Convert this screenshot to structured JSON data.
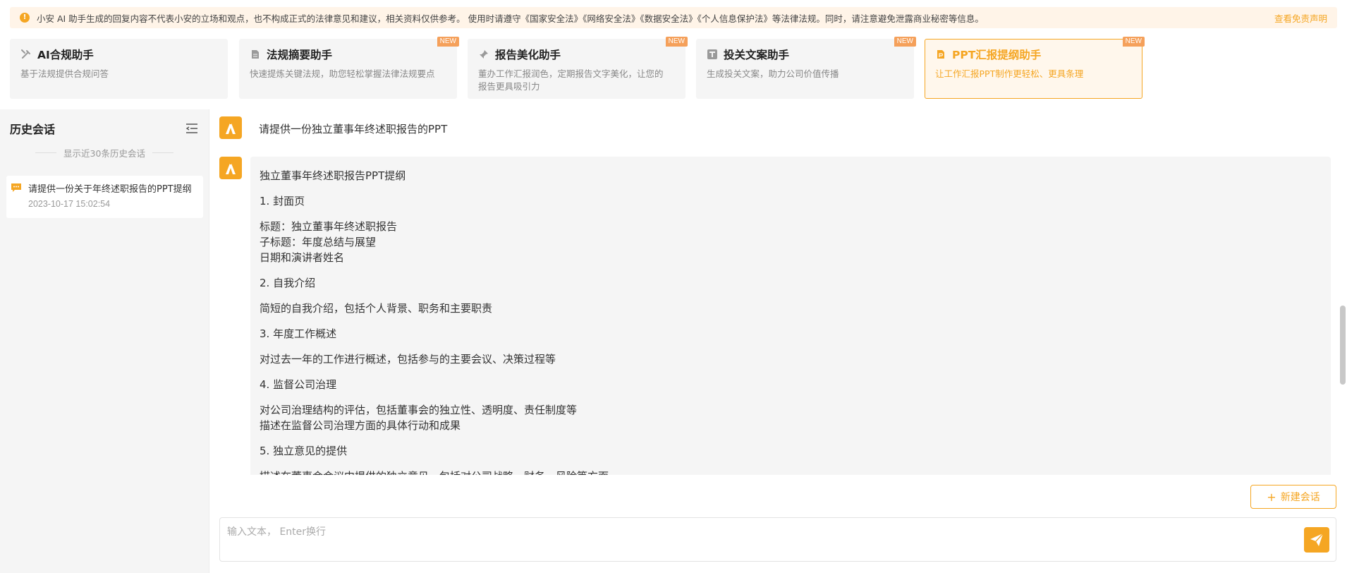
{
  "notice": {
    "text": "小安 AI 助手生成的回复内容不代表小安的立场和观点，也不构成正式的法律意见和建议，相关资料仅供参考。 使用时请遵守《国家安全法》《网络安全法》《数据安全法》《个人信息保护法》等法律法规。同时，请注意避免泄露商业秘密等信息。",
    "link": "查看免责声明"
  },
  "tools": [
    {
      "title": "AI合规助手",
      "desc": "基于法规提供合规问答",
      "badge": "",
      "icon": "tools-icon"
    },
    {
      "title": "法规摘要助手",
      "desc": "快速提炼关键法规，助您轻松掌握法律法规要点",
      "badge": "NEW",
      "icon": "document-icon"
    },
    {
      "title": "报告美化助手",
      "desc": "董办工作汇报润色，定期报告文字美化，让您的报告更具吸引力",
      "badge": "NEW",
      "icon": "pin-icon"
    },
    {
      "title": "投关文案助手",
      "desc": "生成投关文案，助力公司价值传播",
      "badge": "NEW",
      "icon": "text-icon"
    },
    {
      "title": "PPT汇报提纲助手",
      "desc": "让工作汇报PPT制作更轻松、更具条理",
      "badge": "NEW",
      "icon": "ppt-file-icon"
    }
  ],
  "sidebar": {
    "title": "历史会话",
    "subtitle": "显示近30条历史会话",
    "items": [
      {
        "title": "请提供一份关于年终述职报告的PPT提纲",
        "time": "2023-10-17 15:02:54"
      }
    ]
  },
  "chat": {
    "question": "请提供一份独立董事年终述职报告的PPT",
    "answer": {
      "title": "独立董事年终述职报告PPT提纲",
      "s1": "1. 封面页",
      "s1_l1": "标题：独立董事年终述职报告",
      "s1_l2": "子标题：年度总结与展望",
      "s1_l3": "日期和演讲者姓名",
      "s2": "2. 自我介绍",
      "s2_l1": "简短的自我介绍，包括个人背景、职务和主要职责",
      "s3": "3. 年度工作概述",
      "s3_l1": "对过去一年的工作进行概述，包括参与的主要会议、决策过程等",
      "s4": "4. 监督公司治理",
      "s4_l1": "对公司治理结构的评估，包括董事会的独立性、透明度、责任制度等",
      "s4_l2": "描述在监督公司治理方面的具体行动和成果",
      "s5": "5. 独立意见的提供",
      "s5_l1": "描述在董事会会议中提供的独立意见，包括对公司战略、财务、风险等方面"
    }
  },
  "actions": {
    "new_chat": "新建会话",
    "input_placeholder": "输入文本， Enter换行"
  },
  "colors": {
    "accent": "#f5a623",
    "notice_bg": "#fff4e8",
    "panel_bg": "#f5f5f5"
  }
}
